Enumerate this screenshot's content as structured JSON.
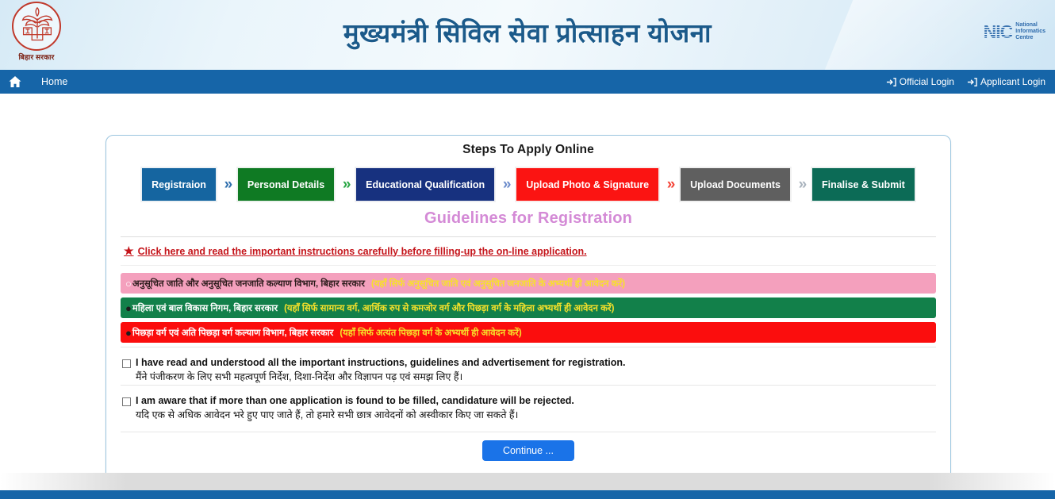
{
  "header": {
    "emblem_label": "बिहार सरकार",
    "emblem_icon": "bihar-government-emblem",
    "title": "मुख्यमंत्री सिविल सेवा प्रोत्साहन योजना",
    "nic_mark": "NIC",
    "nic_line1": "National",
    "nic_line2": "Informatics",
    "nic_line3": "Centre"
  },
  "navbar": {
    "home_icon": "home-icon",
    "home_label": "Home",
    "links": [
      {
        "label": "Official Login",
        "icon": "sign-in-icon"
      },
      {
        "label": "Applicant Login",
        "icon": "sign-in-icon"
      }
    ]
  },
  "panel": {
    "title": "Steps To Apply Online",
    "guidelines_title": "Guidelines for Registration",
    "instruction_link": "Click here and read the important instructions carefully before filling-up the on-line application.",
    "instruction_icon": "star-icon"
  },
  "steps": [
    {
      "label": "Registraion",
      "bg": "#1565a0",
      "chevron_color": "#2f6fad"
    },
    {
      "label": "Personal Details",
      "bg": "#0f7a23",
      "chevron_color": "#2aa745"
    },
    {
      "label": "Educational Qualification",
      "bg": "#17317f",
      "chevron_color": "#6d8ccb"
    },
    {
      "label": "Upload Photo & Signature",
      "bg": "#fb1412",
      "chevron_color": "#f44336"
    },
    {
      "label": "Upload Documents",
      "bg": "#5f5f5f",
      "chevron_color": "#a9b3bd"
    },
    {
      "label": "Finalise & Submit",
      "bg": "#0c6b56",
      "chevron_color": "#0c6b56"
    }
  ],
  "departments": [
    {
      "bullet": "○",
      "name": "अनुसूचित जाति और अनुसूचित जनजाति कल्याण विभाग, बिहार सरकार",
      "note": "(यहाँ सिर्फ अनुसूचित जाति एवं अनुसूचित जनजाति के अभ्यर्थी ही आवेदन करें)",
      "bg": "#f4a0bd",
      "name_color": "#2b1b1b",
      "note_color": "#f7e12a"
    },
    {
      "bullet": "●",
      "name": "महिला एवं बाल विकास निगम, बिहार सरकार",
      "note": "(यहाँ सिर्फ सामान्य वर्ग, आर्थिक रुप से कमजोर वर्ग और पिछड़ा वर्ग के महिला अभ्यर्थी ही आवेदन करें)",
      "bg": "#12804a",
      "name_color": "#ffffff",
      "note_color": "#f7e12a"
    },
    {
      "bullet": "●",
      "name": "पिछड़ा वर्ग एवं अति पिछड़ा वर्ग कल्याण विभाग, बिहार सरकार",
      "note": "(यहाँ सिर्फ अत्यंत पिछड़ा वर्ग के अभ्यर्थी ही आवेदन करें)",
      "bg": "#fb0d0d",
      "name_color": "#ffffff",
      "note_color": "#f7e12a"
    }
  ],
  "declarations": [
    {
      "english": "I have read and understood all the important instructions, guidelines and advertisement for registration.",
      "hindi": "मैंने पंजीकरण के लिए सभी महत्वपूर्ण निर्देश, दिशा-निर्देश और विज्ञापन पढ़ एवं समझ लिए हैं।",
      "checked": false
    },
    {
      "english": "I am aware that if more than one application is found to be filled, candidature will be rejected.",
      "hindi": "यदि एक से अधिक आवेदन भरे हुए पाए जाते हैं, तो हमारे सभी छात्र आवेदनों को अस्वीकार किए जा सकते हैं।",
      "checked": false
    }
  ],
  "actions": {
    "continue_label": "Continue ..."
  },
  "colors": {
    "navbar": "#1665a8",
    "footer": "#1665a8",
    "accent_blue": "#1a73e8",
    "link_red": "#c5151b",
    "guidelines_pink": "#d48ad6"
  }
}
